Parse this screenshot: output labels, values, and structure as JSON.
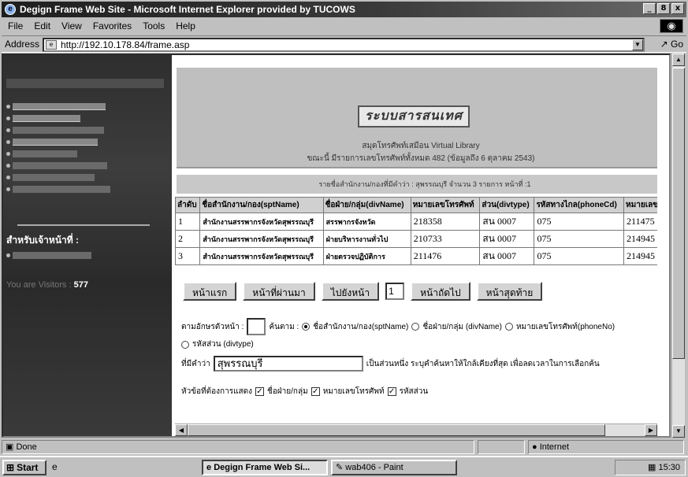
{
  "window": {
    "title": "Degign Frame Web Site - Microsoft Internet Explorer provided by TUCOWS",
    "controls": [
      "_",
      "8",
      "x"
    ]
  },
  "menu": [
    "File",
    "Edit",
    "View",
    "Favorites",
    "Tools",
    "Help"
  ],
  "address": {
    "label": "Address",
    "url": "http://192.10.178.84/frame.asp",
    "go": "Go"
  },
  "left_frame": {
    "staff_heading": "สำหรับเจ้าหน้าที่ :",
    "visitors_label": "You are Visitors :",
    "visitors_count": "577"
  },
  "banner": {
    "subtitle": "สมุดโทรศัพท์เสมือน Virtual Library",
    "info": "ขณะนี้ มีรายการเลขโทรศัพท์ทั้งหมด 482 (ข้อมูลถึง 6 ตุลาคม 2543)"
  },
  "list_heading": "รายชื่อสำนักงาน/กองที่มีคำว่า : สุพรรณบุรี จำนวน 3 รายการ หน้าที่ :1",
  "table": {
    "headers": [
      "ลำดับ",
      "ชื่อสำนักงาน/กอง(sptName)",
      "ชื่อฝ่าย/กลุ่ม(divName)",
      "หมายเลขโทรศัพท์",
      "ส่วน(divtype)",
      "รหัสทางไกล(phoneCd)",
      "หมายเลข Fax"
    ],
    "rows": [
      [
        "1",
        "สำนักงานสรรพากรจังหวัดสุพรรณบุรี",
        "สรรพากรจังหวัด",
        "218358",
        "สน 0007",
        "075",
        "211475"
      ],
      [
        "2",
        "สำนักงานสรรพากรจังหวัดสุพรรณบุรี",
        "ฝ่ายบริหารงานทั่วไป",
        "210733",
        "สน 0007",
        "075",
        "214945"
      ],
      [
        "3",
        "สำนักงานสรรพากรจังหวัดสุพรรณบุรี",
        "ฝ่ายตรวจปฏิบัติการ",
        "211476",
        "สน 0007",
        "075",
        "214945"
      ]
    ]
  },
  "pager": {
    "first": "หน้าแรก",
    "prev": "หน้าที่ผ่านมา",
    "goto": "ไปยังหน้า",
    "page_value": "1",
    "next": "หน้าถัดไป",
    "last": "หน้าสุดท้าย"
  },
  "search": {
    "char_label": "ตามอักษรตัวหน้า :",
    "field_label": "ค้นตาม :",
    "options": [
      "ชื่อสำนักงาน/กอง(sptName)",
      "ชื่อฝ่าย/กลุ่ม (divName)",
      "หมายเลขโทรศัพท์(phoneNo)",
      "รหัสส่วน (divtype)"
    ],
    "keyword_label": "ที่มีคำว่า",
    "keyword_value": "สุพรรณบุรี",
    "hint": "เป็นส่วนหนึ่ง ระบุคำค้นหาให้ใกล้เคียงที่สุด เพื่อลดเวลาในการเลือกค้น",
    "display_label": "หัวข้อที่ต้องการแสดง",
    "display_options": [
      "ชื่อฝ่าย/กลุ่ม",
      "หมายเลขโทรศัพท์",
      "รหัสส่วน"
    ]
  },
  "status": {
    "text": "Done",
    "zone": "Internet"
  },
  "taskbar": {
    "start": "Start",
    "tasks": [
      "Degign Frame Web Si...",
      "wab406 - Paint"
    ],
    "clock": "15:30"
  }
}
